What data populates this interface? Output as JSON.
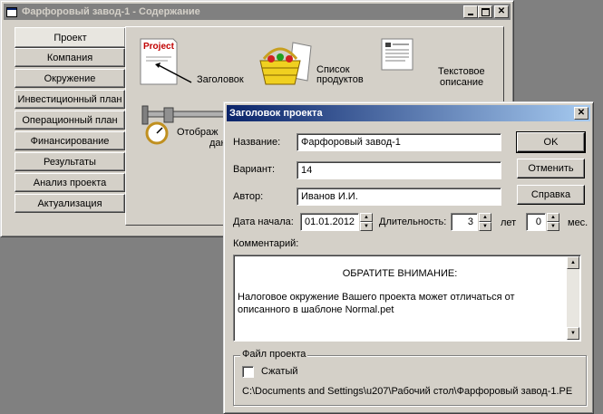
{
  "main_window": {
    "title": "Фарфоровый завод-1 - Содержание",
    "nav": [
      {
        "label": "Проект"
      },
      {
        "label": "Компания"
      },
      {
        "label": "Окружение"
      },
      {
        "label": "Инвестиционный план"
      },
      {
        "label": "Операционный план"
      },
      {
        "label": "Финансирование"
      },
      {
        "label": "Результаты"
      },
      {
        "label": "Анализ проекта"
      },
      {
        "label": "Актуализация"
      }
    ],
    "icons": {
      "project_badge": "Project",
      "header": "Заголовок",
      "products_line1": "Список",
      "products_line2": "продуктов",
      "text_line1": "Текстовое",
      "text_line2": "описание",
      "display_line1": "Отображ",
      "display_line2": "дан"
    }
  },
  "dialog": {
    "title": "Заголовок проекта",
    "name_label": "Название:",
    "name_value": "Фарфоровый завод-1",
    "variant_label": "Вариант:",
    "variant_value": "14",
    "author_label": "Автор:",
    "author_value": "Иванов И.И.",
    "start_label": "Дата начала:",
    "start_value": "01.01.2012",
    "duration_label": "Длительность:",
    "years_value": "3",
    "years_label": "лет",
    "months_value": "0",
    "months_label": "мес.",
    "comment_label": "Комментарий:",
    "comment_heading": "ОБРАТИТЕ ВНИМАНИЕ:",
    "comment_body": "Налоговое окружение Вашего проекта может отличаться от описанного в шаблоне Normal.pet",
    "buttons": {
      "ok": "OK",
      "cancel": "Отменить",
      "help": "Справка"
    },
    "file_group_label": "Файл проекта",
    "compressed_label": "Сжатый",
    "file_path": "C:\\Documents and Settings\\u207\\Рабочий стол\\Фарфоровый завод-1.PE"
  },
  "colors": {
    "active_title": "#0a246a",
    "inactive_title": "#808080",
    "face": "#d4d0c8"
  }
}
